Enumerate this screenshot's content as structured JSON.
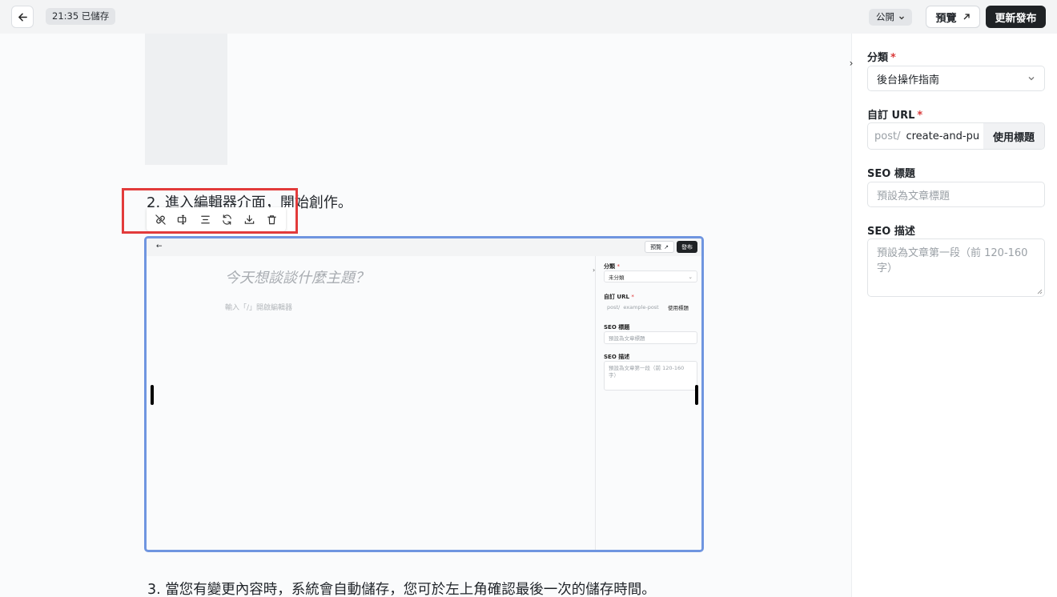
{
  "topbar": {
    "saved_status": "21:35 已儲存",
    "visibility": "公開",
    "preview_label": "預覽",
    "publish_label": "更新發布"
  },
  "editor": {
    "heading_step2": "2. 進入編輯器介面，開始創作。",
    "paragraph_step3": "3. 當您有變更內容時，系統會自動儲存，您可於左上角確認最後一次的儲存時間。",
    "image_toolbar": [
      "unlink-icon",
      "alt-text-icon",
      "align-center-icon",
      "replace-icon",
      "download-icon",
      "delete-icon"
    ]
  },
  "embedded_screenshot": {
    "preview_label": "預覽",
    "publish_label": "發布",
    "title_placeholder": "今天想談談什麼主題？",
    "hint": "輸入「/」開啟編輯器",
    "category_label": "分類",
    "category_value": "未分類",
    "url_label": "自訂 URL",
    "url_prefix": "post/",
    "url_slug": "example-post",
    "use_title": "使用標題",
    "seo_title_label": "SEO 標題",
    "seo_title_placeholder": "預設為文章標題",
    "seo_desc_label": "SEO 描述",
    "seo_desc_placeholder": "預設為文章第一段（前 120-160 字）"
  },
  "sidebar": {
    "category_label": "分類",
    "category_value": "後台操作指南",
    "url_label": "自訂 URL",
    "url_prefix": "post/",
    "url_slug": "create-and-pub",
    "use_title_label": "使用標題",
    "seo_title_label": "SEO 標題",
    "seo_title_placeholder": "預設為文章標題",
    "seo_desc_label": "SEO 描述",
    "seo_desc_placeholder": "預設為文章第一段（前 120-160 字）",
    "required_mark": "*"
  },
  "colors": {
    "accent_dark": "#1f2225",
    "highlight_red": "#e23b3b",
    "selection_blue": "#6f95e0",
    "required": "#d93a3a"
  }
}
